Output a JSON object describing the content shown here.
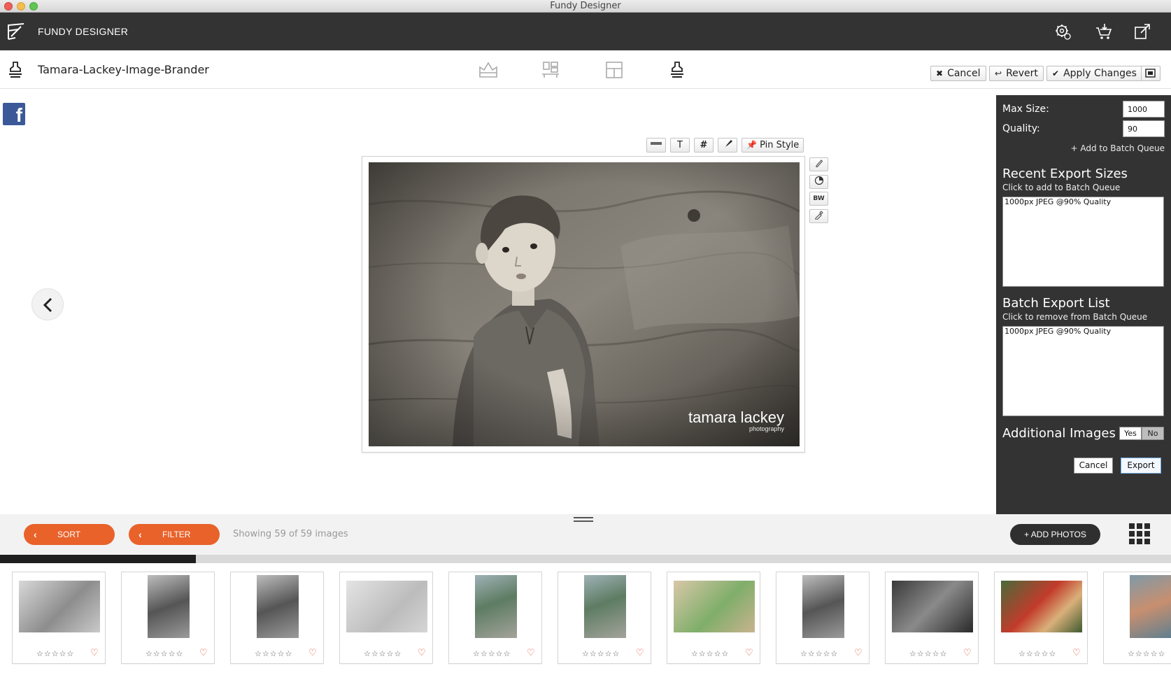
{
  "window": {
    "title": "Fundy Designer"
  },
  "app": {
    "name": "FUNDY DESIGNER"
  },
  "toolbar": {
    "project_title": "Tamara-Lackey-Image-Brander",
    "cancel_label": "Cancel",
    "revert_label": "Revert",
    "apply_label": "Apply Changes"
  },
  "canvas_tools": {
    "text_glyph": "T",
    "hash_glyph": "#",
    "pin_style_label": "Pin Style",
    "bw_label": "BW"
  },
  "photo": {
    "watermark_main": "tamara lackey",
    "watermark_sub": "photography"
  },
  "export_panel": {
    "max_size_label": "Max Size:",
    "max_size_value": "1000",
    "quality_label": "Quality:",
    "quality_value": "90",
    "add_to_batch": "+ Add to Batch Queue",
    "recent_title": "Recent Export Sizes",
    "recent_sub": "Click to add to Batch Queue",
    "recent_items": [
      "1000px JPEG @90% Quality"
    ],
    "batch_title": "Batch Export List",
    "batch_sub": "Click to remove from Batch Queue",
    "batch_items": [
      "1000px JPEG @90% Quality"
    ],
    "additional_label": "Additional Images",
    "yes_label": "Yes",
    "no_label": "No",
    "cancel_label": "Cancel",
    "export_label": "Export"
  },
  "bottom_bar": {
    "sort_label": "SORT",
    "filter_label": "FILTER",
    "showing_text": "Showing 59 of 59 images",
    "add_photos_label": "+ ADD PHOTOS",
    "scroll_progress": 0.167
  },
  "thumbnails": [
    {
      "kind": "landscape-bw",
      "rating": "☆☆☆☆☆"
    },
    {
      "kind": "portrait-bw",
      "rating": "☆☆☆☆☆"
    },
    {
      "kind": "portrait-bw",
      "rating": "☆☆☆☆☆"
    },
    {
      "kind": "landscape-light",
      "rating": "☆☆☆☆☆"
    },
    {
      "kind": "portrait-color",
      "rating": "☆☆☆☆☆"
    },
    {
      "kind": "portrait-color",
      "rating": "☆☆☆☆☆"
    },
    {
      "kind": "landscape-color",
      "rating": "☆☆☆☆☆"
    },
    {
      "kind": "portrait-bw",
      "rating": "☆☆☆☆☆"
    },
    {
      "kind": "landscape-dark",
      "rating": "☆☆☆☆☆"
    },
    {
      "kind": "landscape-color2",
      "rating": "☆☆☆☆☆"
    },
    {
      "kind": "portrait-color2",
      "rating": "☆☆☆☆☆"
    }
  ],
  "colors": {
    "accent": "#e8622a",
    "header": "#333333",
    "panel": "#333333",
    "heart": "#e0452a"
  },
  "icons": [
    "fundy-logo-icon",
    "settings-icon",
    "cart-icon",
    "share-out-icon",
    "stamp-icon",
    "album-icon",
    "layout-icon",
    "grid-layout-icon",
    "brander-icon",
    "cancel-x-icon",
    "revert-icon",
    "check-icon",
    "preview-icon",
    "facebook-icon",
    "chevron-left-icon",
    "grid-view-icon"
  ]
}
